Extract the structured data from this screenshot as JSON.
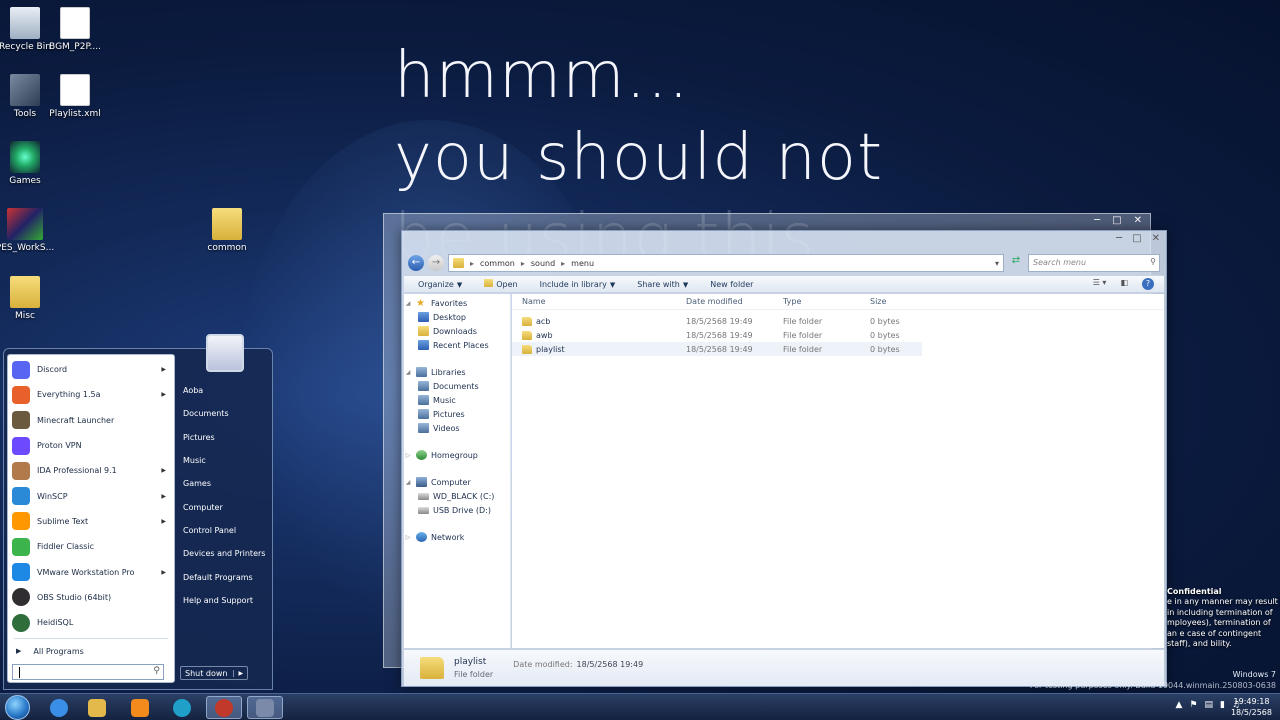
{
  "overlay": {
    "line1": "hmmm...",
    "line2": "you should not",
    "line3": "be using this"
  },
  "desktop_icons": [
    {
      "label": "Recycle Bin",
      "icon": "recycle-bin-icon"
    },
    {
      "label": "BGM_P2P....",
      "icon": "document-icon"
    },
    {
      "label": "Tools",
      "icon": "tools-icon"
    },
    {
      "label": "Playlist.xml",
      "icon": "document-icon"
    },
    {
      "label": "Games",
      "icon": "games-icon"
    },
    {
      "label": "PES_WorkS...",
      "icon": "pes-icon"
    },
    {
      "label": "Misc",
      "icon": "folder-icon"
    },
    {
      "label": "common",
      "icon": "folder-icon"
    }
  ],
  "explorer": {
    "breadcrumb": [
      "common",
      "sound",
      "menu"
    ],
    "search_placeholder": "Search menu",
    "toolbar": {
      "organize": "Organize",
      "open": "Open",
      "include": "Include in library",
      "share": "Share with",
      "new_folder": "New folder"
    },
    "nav": {
      "favorites": "Favorites",
      "desktop": "Desktop",
      "downloads": "Downloads",
      "recent": "Recent Places",
      "libraries": "Libraries",
      "documents": "Documents",
      "music": "Music",
      "pictures": "Pictures",
      "videos": "Videos",
      "homegroup": "Homegroup",
      "computer": "Computer",
      "drive_c": "WD_BLACK (C:)",
      "drive_d": "USB Drive (D:)",
      "network": "Network"
    },
    "columns": {
      "name": "Name",
      "date": "Date modified",
      "type": "Type",
      "size": "Size"
    },
    "files": [
      {
        "name": "acb",
        "date": "18/5/2568 19:49",
        "type": "File folder",
        "size": "0 bytes"
      },
      {
        "name": "awb",
        "date": "18/5/2568 19:49",
        "type": "File folder",
        "size": "0 bytes"
      },
      {
        "name": "playlist",
        "date": "18/5/2568 19:49",
        "type": "File folder",
        "size": "0 bytes"
      }
    ],
    "details": {
      "name": "playlist",
      "type": "File folder",
      "modified_label": "Date modified:",
      "modified_value": "18/5/2568 19:49"
    }
  },
  "start_menu": {
    "programs": [
      {
        "label": "Discord",
        "submenu": true,
        "icon": "discord-icon",
        "color": "#5865f2"
      },
      {
        "label": "Everything 1.5a",
        "submenu": true,
        "icon": "everything-search-icon",
        "color": "#e8602c"
      },
      {
        "label": "Minecraft Launcher",
        "submenu": false,
        "icon": "minecraft-icon",
        "color": "#6b5a3e"
      },
      {
        "label": "Proton VPN",
        "submenu": false,
        "icon": "proton-vpn-icon",
        "color": "#6d4aff"
      },
      {
        "label": "IDA Professional 9.1",
        "submenu": true,
        "icon": "ida-icon",
        "color": "#b07a4a"
      },
      {
        "label": "WinSCP",
        "submenu": true,
        "icon": "winscp-icon",
        "color": "#2a8ad8"
      },
      {
        "label": "Sublime Text",
        "submenu": true,
        "icon": "sublime-text-icon",
        "color": "#ff9800"
      },
      {
        "label": "Fiddler Classic",
        "submenu": false,
        "icon": "fiddler-icon",
        "color": "#3cb44b"
      },
      {
        "label": "VMware Workstation Pro",
        "submenu": true,
        "icon": "vmware-icon",
        "color": "#1e88e5"
      },
      {
        "label": "OBS Studio (64bit)",
        "submenu": false,
        "icon": "obs-icon",
        "color": "#302e31"
      },
      {
        "label": "HeidiSQL",
        "submenu": false,
        "icon": "heidisql-icon",
        "color": "#2f6e3b"
      }
    ],
    "all_programs": "All Programs",
    "right": [
      "Aoba",
      "Documents",
      "Pictures",
      "Music",
      "Games",
      "Computer",
      "Control Panel",
      "Devices and Printers",
      "Default Programs",
      "Help and Support"
    ],
    "shutdown": "Shut down"
  },
  "confidential": {
    "heading": "Confidential",
    "body": "e in any manner may result in including termination of mployees), termination of an e case of contingent staff), and bility."
  },
  "watermark": {
    "line1": "Windows 7",
    "line2": "For testing purposes only. Build 19044.winmain.250803-0638"
  },
  "taskbar": {
    "apps": [
      {
        "icon": "internet-explorer-icon",
        "color": "#3a8ee6"
      },
      {
        "icon": "file-explorer-icon",
        "color": "#e2b94a"
      },
      {
        "icon": "media-player-icon",
        "color": "#f28a1c"
      },
      {
        "icon": "edge-icon",
        "color": "#1fa0c8"
      },
      {
        "icon": "app-icon",
        "color": "#c0392b"
      },
      {
        "icon": "app-icon-2",
        "color": "#7a8aa8"
      }
    ],
    "time": "19:49:18",
    "date": "18/5/2568"
  }
}
